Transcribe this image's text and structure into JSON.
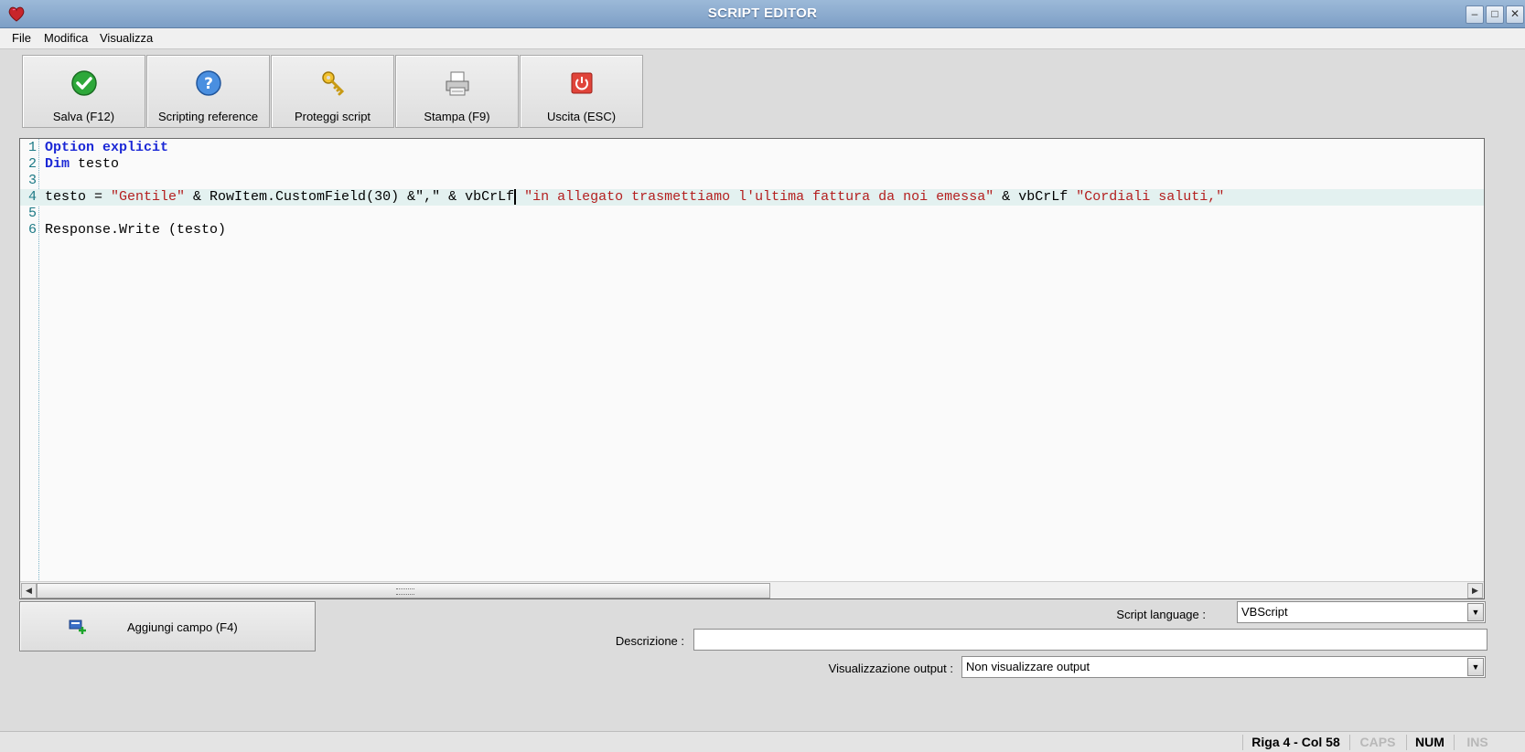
{
  "window": {
    "title": "SCRIPT EDITOR"
  },
  "menu": {
    "file": "File",
    "modifica": "Modifica",
    "visualizza": "Visualizza"
  },
  "toolbar": {
    "salva": "Salva (F12)",
    "scripting": "Scripting reference",
    "proteggi": "Proteggi script",
    "stampa": "Stampa (F9)",
    "uscita": "Uscita (ESC)"
  },
  "editor": {
    "lines": [
      {
        "n": "1",
        "tokens": [
          {
            "t": "Option explicit",
            "c": "kw"
          }
        ]
      },
      {
        "n": "2",
        "tokens": [
          {
            "t": "Dim",
            "c": "kw"
          },
          {
            "t": " testo",
            "c": ""
          }
        ]
      },
      {
        "n": "3",
        "tokens": []
      },
      {
        "n": "4",
        "tokens": [
          {
            "t": "testo = ",
            "c": ""
          },
          {
            "t": "\"Gentile\"",
            "c": "str"
          },
          {
            "t": " & RowItem.CustomField(30) &\",\" & vbCrLf",
            "c": ""
          },
          {
            "t": "",
            "c": "caret"
          },
          {
            "t": " ",
            "c": ""
          },
          {
            "t": "\"in allegato trasmettiamo l'ultima fattura da noi emessa\"",
            "c": "str"
          },
          {
            "t": " & vbCrLf ",
            "c": ""
          },
          {
            "t": "\"Cordiali saluti,\"",
            "c": "str"
          }
        ]
      },
      {
        "n": "5",
        "tokens": []
      },
      {
        "n": "6",
        "tokens": [
          {
            "t": "Response.Write (testo)",
            "c": ""
          }
        ]
      }
    ],
    "current_line": 4
  },
  "add_field": {
    "label": "Aggiungi campo (F4)"
  },
  "form": {
    "script_language_label": "Script language :",
    "script_language_value": "VBScript",
    "descrizione_label": "Descrizione :",
    "descrizione_value": "",
    "output_label": "Visualizzazione output :",
    "output_value": "Non visualizzare output"
  },
  "status": {
    "position": "Riga 4 - Col 58",
    "caps": "CAPS",
    "num": "NUM",
    "ins": "INS"
  }
}
